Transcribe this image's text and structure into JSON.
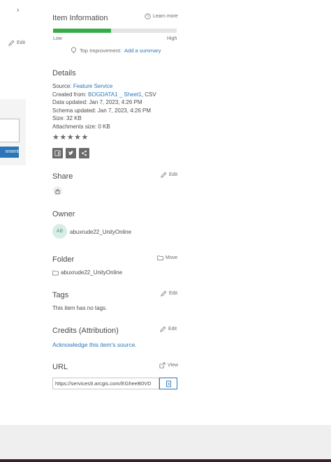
{
  "left": {
    "edit_label": "Edit",
    "button_label": "nment"
  },
  "item_info": {
    "title": "Item Information",
    "learn_more": "Learn more",
    "progress_fraction": 0.47,
    "low_label": "Low",
    "high_label": "High",
    "top_improvement_label": "Top Improvement:",
    "add_summary": "Add a summary"
  },
  "details": {
    "title": "Details",
    "source_label": "Source:",
    "source_value": "Feature Service",
    "created_label": "Created from:",
    "created_value": "BOGDATA1 _ Sheet1",
    "created_suffix": ", CSV",
    "data_updated": "Data updated: Jan 7, 2023, 4:26 PM",
    "schema_updated": "Schema updated: Jan 7, 2023, 4:26 PM",
    "size": "Size: 32 KB",
    "attachments": "Attachments size: 0 KB",
    "rating": 0
  },
  "share": {
    "title": "Share",
    "edit_label": "Edit"
  },
  "owner": {
    "title": "Owner",
    "initials": "AB",
    "name": "abuxrude22_UnityOnline"
  },
  "folder": {
    "title": "Folder",
    "move_label": "Move",
    "name": "abuxrude22_UnityOnline"
  },
  "tags": {
    "title": "Tags",
    "edit_label": "Edit",
    "empty_text": "This item has no tags."
  },
  "credits": {
    "title": "Credits (Attribution)",
    "edit_label": "Edit",
    "link_text": "Acknowledge this item's source."
  },
  "url": {
    "title": "URL",
    "view_label": "View",
    "value": "https://services9.arcgis.com/EGheeB0VD"
  },
  "colors": {
    "accent": "#2a76b8",
    "progress": "#35ac46",
    "footer": "#efefef",
    "bottom_bar": "#3d1f2a"
  }
}
